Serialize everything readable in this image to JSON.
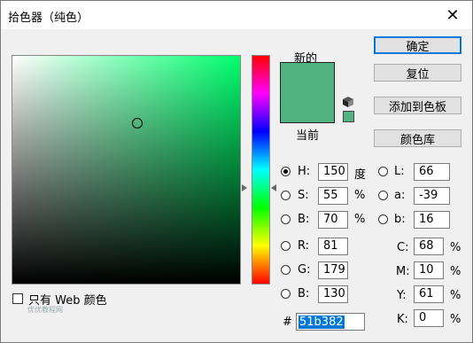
{
  "window": {
    "title": "拾色器（纯色）",
    "close_glyph": "✕"
  },
  "preview": {
    "new_label": "新的",
    "current_label": "当前",
    "new_color": "#51b382",
    "current_color": "#51b382"
  },
  "buttons": {
    "ok": "确定",
    "reset": "复位",
    "add_swatch": "添加到色板",
    "color_library": "颜色库"
  },
  "fields": {
    "h": {
      "label": "H:",
      "value": "150",
      "unit": "度",
      "selected": true
    },
    "s": {
      "label": "S:",
      "value": "55",
      "unit": "%"
    },
    "b": {
      "label": "B:",
      "value": "70",
      "unit": "%"
    },
    "r": {
      "label": "R:",
      "value": "81"
    },
    "g": {
      "label": "G:",
      "value": "179"
    },
    "b2": {
      "label": "B:",
      "value": "130"
    },
    "l": {
      "label": "L:",
      "value": "66"
    },
    "a": {
      "label": "a:",
      "value": "-39"
    },
    "lab_b": {
      "label": "b:",
      "value": "16"
    },
    "c": {
      "label": "C:",
      "value": "68",
      "unit": "%"
    },
    "m": {
      "label": "M:",
      "value": "10",
      "unit": "%"
    },
    "y": {
      "label": "Y:",
      "value": "61",
      "unit": "%"
    },
    "k": {
      "label": "K:",
      "value": "0",
      "unit": "%"
    },
    "hex": {
      "label": "#",
      "value": "51b382"
    }
  },
  "web_only": {
    "label": "只有 Web 颜色",
    "checked": false
  },
  "watermark": "优优教程网",
  "icons": {
    "close": "close-icon",
    "cube": "cube-icon"
  }
}
